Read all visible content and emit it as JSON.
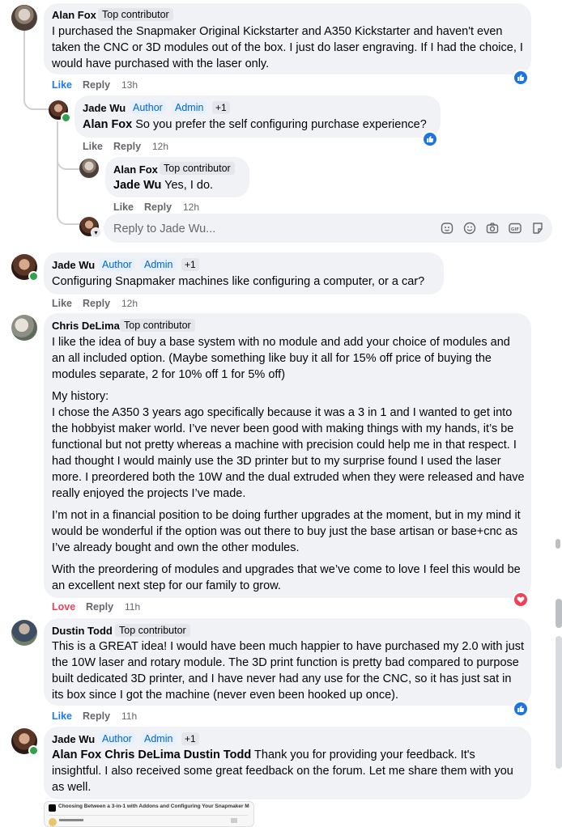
{
  "comments": [
    {
      "author": "Alan Fox",
      "badge": "Top contributor",
      "text": "I purchased the Snapmaker Original Kickstarter and A350 Kickstarter and haven't even taken the CNC or 3D modules out of the box. I just do laser engraving. If I had the choice, I would have purchased with the laser only.",
      "actions": {
        "like": "Like",
        "reply": "Reply",
        "time": "13h"
      },
      "reaction": "like-icon"
    },
    {
      "author": "Jade Wu",
      "badges": [
        "Author",
        "Admin",
        "+1"
      ],
      "mention": "Alan Fox",
      "text": "So you prefer the self configuring purchase experience?",
      "actions": {
        "like": "Like",
        "reply": "Reply",
        "time": "12h"
      },
      "reaction": "like-icon"
    },
    {
      "author": "Alan Fox",
      "badge": "Top contributor",
      "mention": "Jade Wu",
      "text": "Yes, I do.",
      "actions": {
        "like": "Like",
        "reply": "Reply",
        "time": "12h"
      }
    },
    {
      "author": "Jade Wu",
      "badges": [
        "Author",
        "Admin",
        "+1"
      ],
      "text": "Configuring Snapmaker machines like configuring a computer, or a car?",
      "actions": {
        "like": "Like",
        "reply": "Reply",
        "time": "12h"
      }
    },
    {
      "author": "Chris DeLima",
      "badge": "Top contributor",
      "paragraphs": [
        "I like the idea of buy a base system with no module and add your choice of modules and an all included option. (Maybe something like buy it all for 15% off price of buying the modules separate, 2 for 10% off 1 for 5% off)",
        "My history:\nI chose the A350 3 years ago specifically because it was a 3 in 1 and I wanted to get into the hobbyist maker world. I’ve never been good with making things with my hands, it’s be functional but not pretty whereas a machine with precision could help me in that respect. I had thought I would mainly use the 3D printer but to my surprise found I used the laser more. I preordered both the 10W and the dual extruded when they were released and have really enjoyed the projects I’ve made.",
        "I’m not in a financial position to be doing further upgrades at the moment, but in my mind it would be wonderful if the option was out there to buy just the base artisan or base+cnc as I’ve already bought and own the other modules.",
        "With the preordering of modules and upgrades that we’ve come to love I feel this would be an excellent next step for our family to grow."
      ],
      "actions": {
        "like": "Love",
        "reply": "Reply",
        "time": "11h"
      },
      "reaction": "heart-icon"
    },
    {
      "author": "Dustin Todd",
      "badge": "Top contributor",
      "text": "This is a GREAT idea! I would have been much happier to have purchased my 2.0 with just the 10W laser and rotary module. The 3D print function is pretty bad compared to purpose built dedicated 3D printer, and I have never had any use for the CNC, so it has just sat in its box since I got the machine (never even been hooked up once).",
      "actions": {
        "like": "Like",
        "reply": "Reply",
        "time": "11h"
      },
      "reaction": "like-icon"
    },
    {
      "author": "Jade Wu",
      "badges": [
        "Author",
        "Admin",
        "+1"
      ],
      "mention": "Alan Fox Chris DeLima Dustin Todd",
      "text": "Thank you for providing your feedback. It's insightful. I also received some great feedback on the forum. Let me share them with you as well.",
      "attachment_title": "Choosing Between a 3-in-1 with Addons and Configuring Your Snapmaker Mac..."
    }
  ],
  "reply_box": {
    "placeholder": "Reply to Jade Wu...",
    "tools": [
      "sticker-icon",
      "emoji-icon",
      "camera-icon",
      "gif-icon",
      "stickers-icon"
    ]
  },
  "colors": {
    "like": "#1b74e4",
    "love": "#f33e58",
    "bubble": "#f0f2f5",
    "badge_blue": "#0064d1"
  }
}
